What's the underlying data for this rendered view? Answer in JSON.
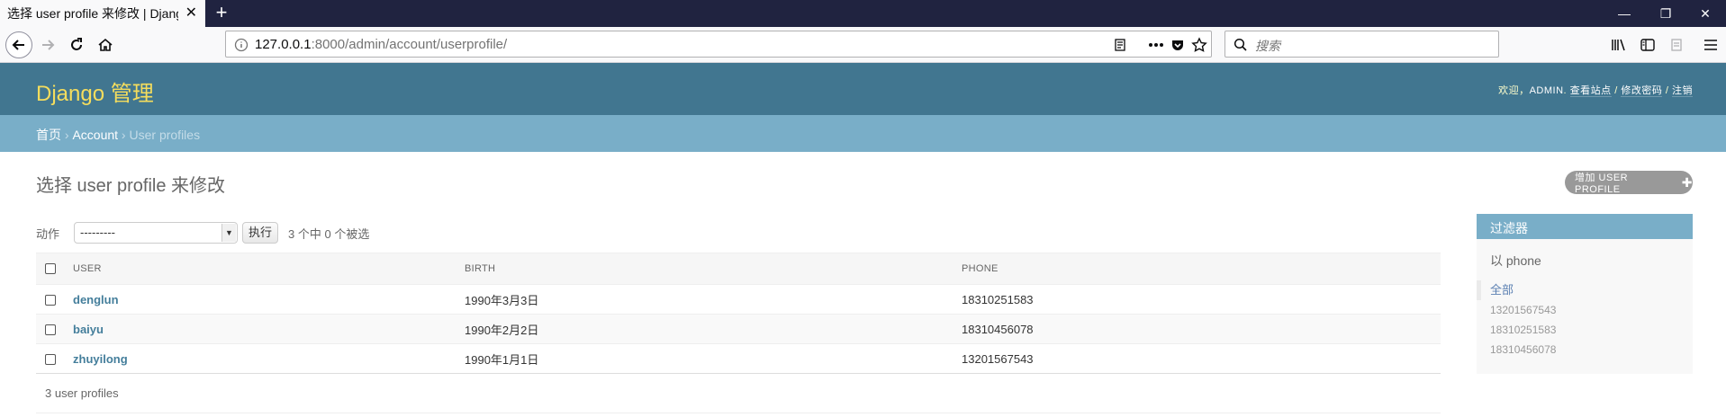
{
  "browser": {
    "tab_title": "选择 user profile 来修改 | Django",
    "new_tab": "+",
    "url_host": "127.0.0.1",
    "url_path": ":8000/admin/account/userprofile/",
    "search_placeholder": "搜索",
    "window_controls": {
      "minimize": "—",
      "restore": "❐",
      "close": "✕"
    }
  },
  "header": {
    "branding": "Django 管理",
    "welcome": "欢迎，",
    "username": "ADMIN",
    "view_site": "查看站点",
    "change_password": "修改密码",
    "logout": "注销",
    "separator": " / "
  },
  "breadcrumbs": {
    "home": "首页",
    "app": "Account",
    "current": "User profiles",
    "separator": " › "
  },
  "content": {
    "title": "选择 user profile 来修改",
    "add_button": "增加 USER PROFILE",
    "actions": {
      "label": "动作",
      "selected": "---------",
      "go_button": "执行",
      "counter": "3 个中 0 个被选"
    },
    "columns": {
      "user": "USER",
      "birth": "BIRTH",
      "phone": "PHONE"
    },
    "rows": [
      {
        "user": "denglun",
        "birth": "1990年3月3日",
        "phone": "18310251583"
      },
      {
        "user": "baiyu",
        "birth": "1990年2月2日",
        "phone": "18310456078"
      },
      {
        "user": "zhuyilong",
        "birth": "1990年1月1日",
        "phone": "13201567543"
      }
    ],
    "paginator": "3 user profiles"
  },
  "filter": {
    "title": "过滤器",
    "by": "以 phone",
    "options": [
      "全部",
      "13201567543",
      "18310251583",
      "18310456078"
    ],
    "selected_index": 0
  },
  "colors": {
    "header_bg": "#417690",
    "branding": "#f5dd5d",
    "breadcrumbs_bg": "#79aec8",
    "link": "#447e9b",
    "tabbar_bg": "#202340"
  }
}
